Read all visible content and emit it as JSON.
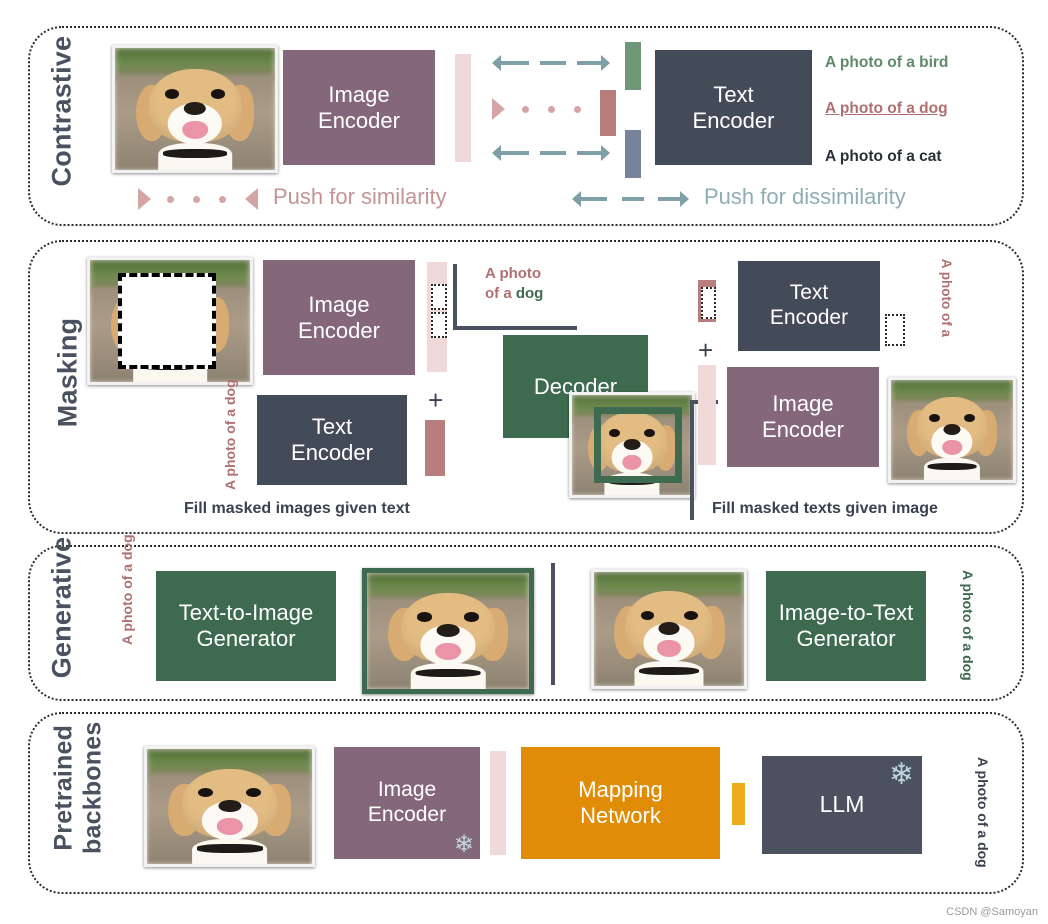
{
  "figure": {
    "watermark": "CSDN @Samoyan"
  },
  "colors": {
    "image_encoder": "#85677b",
    "text_encoder": "#434a58",
    "decoder": "#3e6b4f",
    "generator": "#3e6b4f",
    "mapping_network": "#e08c06",
    "llm": "#4b515e",
    "pink_token": "#f0d9d9",
    "rose_token": "#b87d7d",
    "green_token": "#6f9878",
    "blue_token": "#77839b",
    "similarity": "#c49494",
    "dissimilarity": "#8fadb4",
    "section_label": "#4a5160",
    "caption": "#3b4250",
    "orange_token": "#eeab1e"
  },
  "sections": [
    {
      "id": "contrastive",
      "label": "Contrastive",
      "image_encoder": "Image\nEncoder",
      "image_encoder_line1": "Image",
      "image_encoder_line2": "Encoder",
      "text_encoder_line1": "Text",
      "text_encoder_line2": "Encoder",
      "captions": [
        {
          "text": "A photo of a bird",
          "color": "#5f8a67",
          "underline": false
        },
        {
          "text": "A photo of a dog",
          "color": "#b07070",
          "underline": true
        },
        {
          "text": "A photo of a cat",
          "color": "#2b2f38",
          "underline": false
        }
      ],
      "legend": [
        {
          "text": "Push for similarity",
          "color": "#c49494",
          "marker": "triangles-dots"
        },
        {
          "text": "Push for dissimilarity",
          "color": "#8fadb4",
          "marker": "double-dashed-arrow"
        }
      ]
    },
    {
      "id": "masking",
      "label": "Masking",
      "image_encoder_line1": "Image",
      "image_encoder_line2": "Encoder",
      "text_encoder_line1": "Text",
      "text_encoder_line2": "Encoder",
      "decoder": "Decoder",
      "masked_text_left_line1": "A photo",
      "masked_text_left_line2": "of a dog",
      "predicted_text_line1": "A photo",
      "predicted_text_line2a": "of a ",
      "predicted_text_line2b": "dog",
      "masked_text_right_line1": "A photo",
      "masked_text_right_line2": "of a",
      "right_image_encoder_line1": "Image",
      "right_image_encoder_line2": "Encoder",
      "right_text_encoder_line1": "Text",
      "right_text_encoder_line2": "Encoder",
      "caption_left": "Fill masked images given text",
      "caption_right": "Fill masked texts given image",
      "plus": "+"
    },
    {
      "id": "generative",
      "label": "Generative",
      "left_prompt_line1": "A photo",
      "left_prompt_line2": "of a dog",
      "left_box_line1": "Text-to-Image",
      "left_box_line2": "Generator",
      "right_box_line1": "Image-to-Text",
      "right_box_line2": "Generator",
      "right_output_line1": "A photo",
      "right_output_line2": "of a dog"
    },
    {
      "id": "pretrained",
      "label_line1": "Pretrained",
      "label_line2": "backbones",
      "image_encoder_line1": "Image",
      "image_encoder_line2": "Encoder",
      "mapping_line1": "Mapping",
      "mapping_line2": "Network",
      "llm": "LLM",
      "output_line1": "A photo",
      "output_line2": "of a dog",
      "frozen_icon": "snowflake-icon"
    }
  ]
}
